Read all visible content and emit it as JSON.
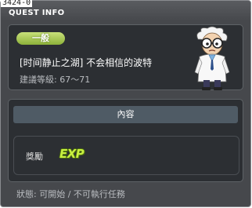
{
  "window": {
    "quest_id": "3424-0",
    "title": "QUEST INFO"
  },
  "quest": {
    "category_badge": "一般",
    "name": "[时间静止之湖] 不会相信的波特",
    "level_requirement": "建議等級: 67～71"
  },
  "content": {
    "header": "內容",
    "reward_label": "獎勵",
    "reward_icon_text": "EXP"
  },
  "status_text": "狀態: 可開始 / 不可執行任務",
  "colors": {
    "window_bg": "#46484c",
    "panel_bg": "#2c2f33",
    "badge_green": "#8db23a",
    "header_bg": "#4f5b65",
    "exp_green": "#c8f040"
  },
  "icons": {
    "npc": "scientist-npc-portrait",
    "reward": "exp-icon"
  }
}
